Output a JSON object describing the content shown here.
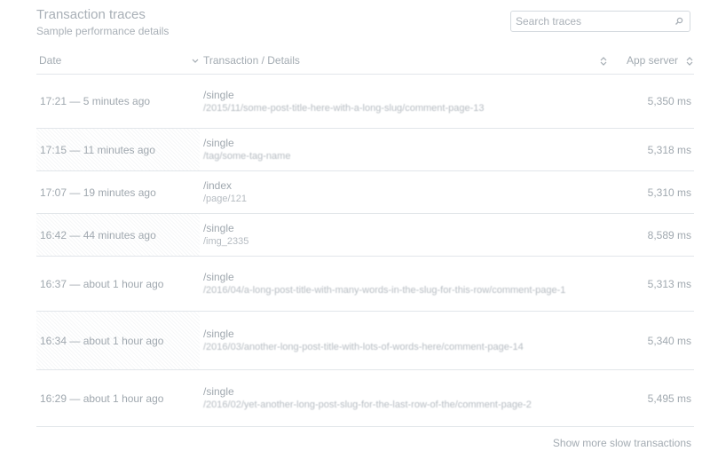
{
  "header": {
    "title": "Transaction traces",
    "subtitle": "Sample performance details"
  },
  "search": {
    "placeholder": "Search traces"
  },
  "table": {
    "columns": [
      "Date",
      "Transaction / Details",
      "App server"
    ],
    "rows": [
      {
        "date": "17:21 — 5 minutes ago",
        "transaction": "/single",
        "details": "/2015/11/some-post-title-here-with-a-long-slug/comment-page-13",
        "app_server": "5,350 ms"
      },
      {
        "date": "17:15 — 11 minutes ago",
        "transaction": "/single",
        "details": "/tag/some-tag-name",
        "app_server": "5,318 ms"
      },
      {
        "date": "17:07 — 19 minutes ago",
        "transaction": "/index",
        "details": "/page/121",
        "app_server": "5,310 ms"
      },
      {
        "date": "16:42 — 44 minutes ago",
        "transaction": "/single",
        "details": "/img_2335",
        "app_server": "8,589 ms"
      },
      {
        "date": "16:37 — about 1 hour ago",
        "transaction": "/single",
        "details": "/2016/04/a-long-post-title-with-many-words-in-the-slug-for-this-row/comment-page-1",
        "app_server": "5,313 ms"
      },
      {
        "date": "16:34 — about 1 hour ago",
        "transaction": "/single",
        "details": "/2016/03/another-long-post-title-with-lots-of-words-here/comment-page-14",
        "app_server": "5,340 ms"
      },
      {
        "date": "16:29 — about 1 hour ago",
        "transaction": "/single",
        "details": "/2016/02/yet-another-long-post-slug-for-the-last-row-of-the/comment-page-2",
        "app_server": "5,495 ms"
      }
    ]
  },
  "footer": {
    "show_more": "Show more slow transactions"
  }
}
